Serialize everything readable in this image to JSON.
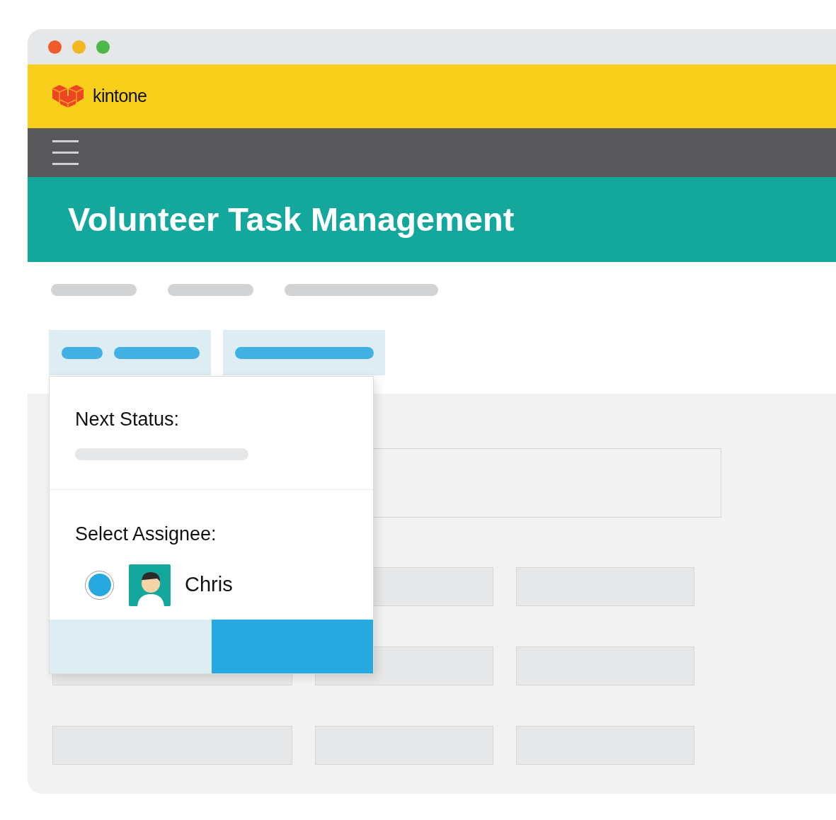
{
  "header": {
    "brand": "kintone"
  },
  "app": {
    "title": "Volunteer Task Management"
  },
  "dialog": {
    "next_status_label": "Next Status:",
    "assignee_label": "Select Assignee:",
    "assignees": [
      {
        "name": "Chris",
        "selected": true
      }
    ]
  }
}
